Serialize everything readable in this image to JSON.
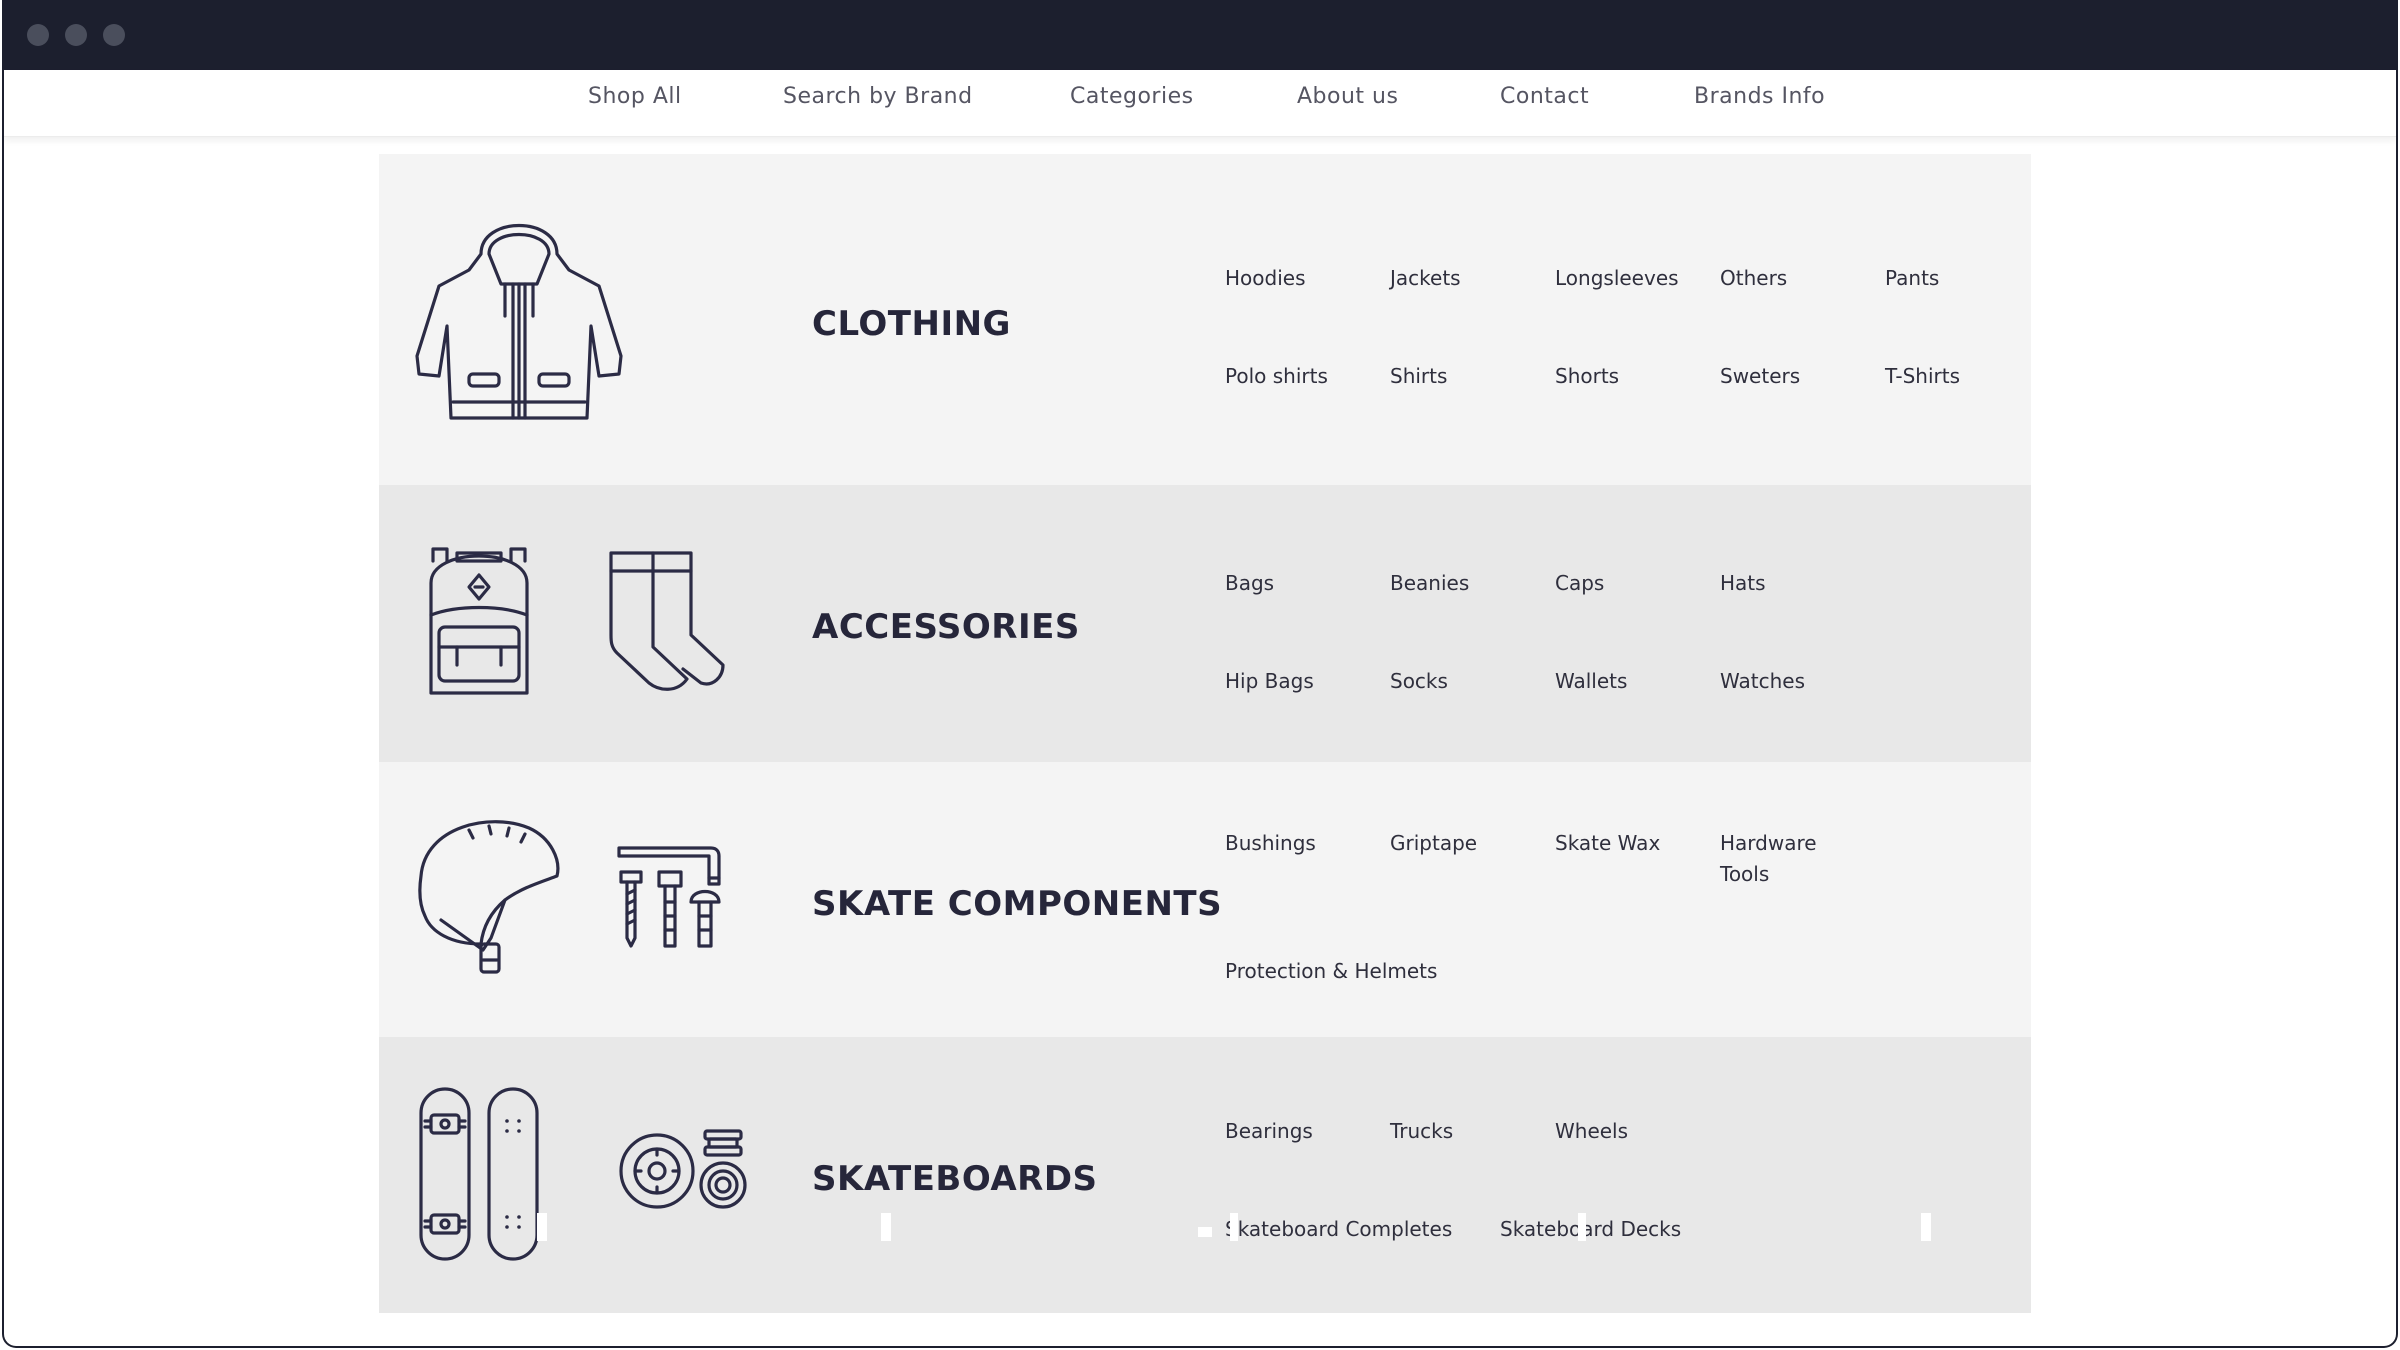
{
  "nav": {
    "items": [
      {
        "label": "Shop All"
      },
      {
        "label": "Search by Brand"
      },
      {
        "label": "Categories"
      },
      {
        "label": "About us"
      },
      {
        "label": "Contact"
      },
      {
        "label": "Brands Info"
      }
    ]
  },
  "categories": [
    {
      "title": "CLOTHING",
      "icons": [
        "hoodie-icon"
      ],
      "links": [
        "Hoodies",
        "Jackets",
        "Longsleeves",
        "Others",
        "Pants",
        "Polo shirts",
        "Shirts",
        "Shorts",
        "Sweters",
        "T-Shirts"
      ]
    },
    {
      "title": "ACCESSORIES",
      "icons": [
        "backpack-icon",
        "socks-icon"
      ],
      "links": [
        "Bags",
        "Beanies",
        "Caps",
        "Hats",
        "Hip Bags",
        "Socks",
        "Wallets",
        "Watches"
      ]
    },
    {
      "title": "SKATE COMPONENTS",
      "icons": [
        "helmet-icon",
        "hardware-tools-icon"
      ],
      "links": [
        "Bushings",
        "Griptape",
        "Skate Wax",
        "Hardware Tools",
        "Protection & Helmets"
      ]
    },
    {
      "title": "SKATEBOARDS",
      "icons": [
        "skateboard-deck-icon",
        "wheels-bearings-icon"
      ],
      "links": [
        "Bearings",
        "Trucks",
        "Wheels",
        "Skateboard Completes",
        "Skateboard Decks"
      ]
    }
  ],
  "colors": {
    "titlebar": "#1c1f2e",
    "panel_light": "#f4f4f4",
    "panel_dark": "#e8e8e8",
    "icon_stroke": "#2b2b45"
  }
}
